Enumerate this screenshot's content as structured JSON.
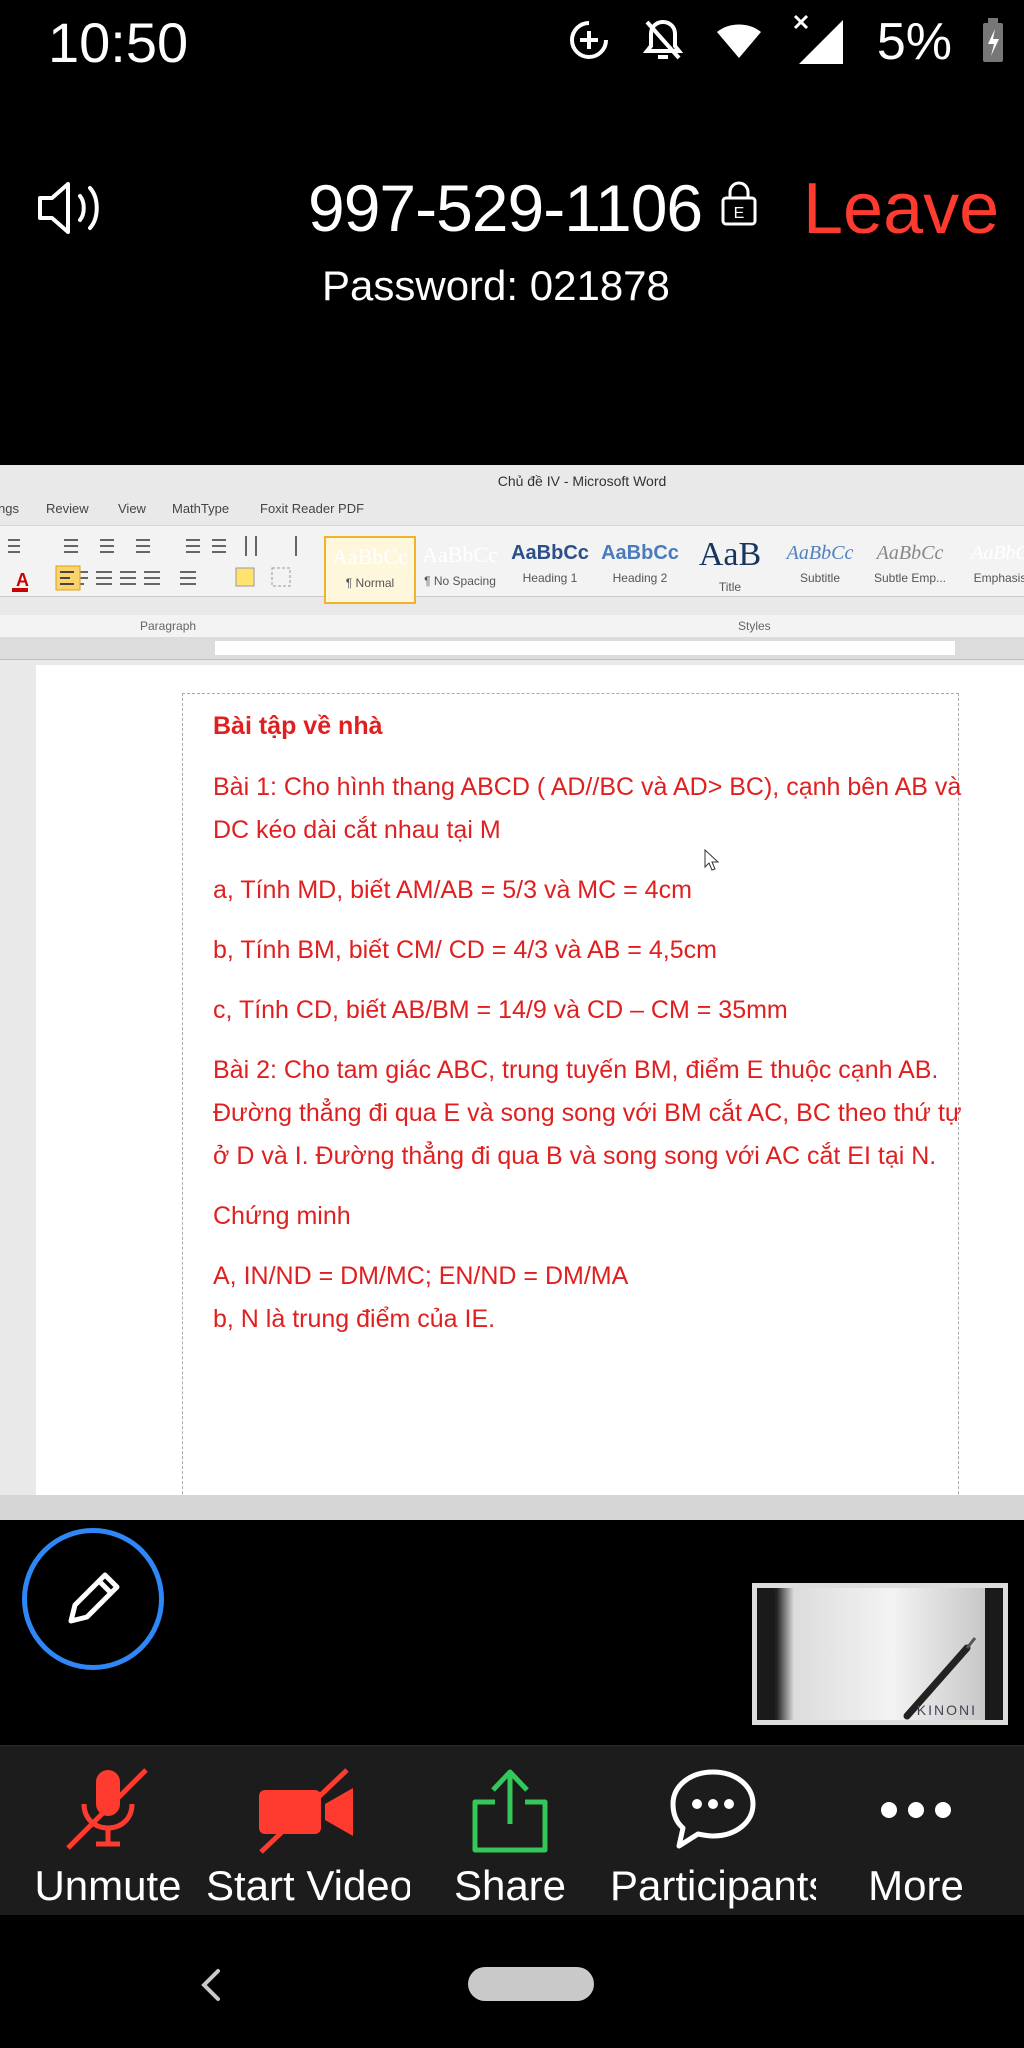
{
  "status_bar": {
    "time": "10:50",
    "battery": "5%",
    "icons": [
      "data-saver-icon",
      "notifications-off-icon",
      "wifi-icon",
      "cellular-signal-icon",
      "battery-charging-icon"
    ]
  },
  "meeting": {
    "id": "997-529-1106",
    "password": "Password: 021878",
    "leave_label": "Leave",
    "leave_color": "#ff3b30"
  },
  "word": {
    "title": "Chủ đề IV - Microsoft Word",
    "tabs": [
      "ngs",
      "Review",
      "View",
      "MathType",
      "Foxit Reader PDF"
    ],
    "styles": [
      {
        "sample": "AaBbCc",
        "name": "¶ Normal"
      },
      {
        "sample": "AaBbCc",
        "name": "¶ No Spacing"
      },
      {
        "sample": "AaBbCc",
        "name": "Heading 1"
      },
      {
        "sample": "AaBbCc",
        "name": "Heading 2"
      },
      {
        "sample": "AaB",
        "name": "Title"
      },
      {
        "sample": "AaBbCc",
        "name": "Subtitle"
      },
      {
        "sample": "AaBbCc",
        "name": "Subtle Emp..."
      },
      {
        "sample": "AaBbC",
        "name": "Emphasis"
      }
    ],
    "group_labels": {
      "paragraph": "Paragraph",
      "styles": "Styles"
    }
  },
  "document": {
    "title": "Bài tập về nhà",
    "lines": [
      "Bài 1: Cho hình thang ABCD ( AD//BC và AD> BC), cạnh bên AB và DC kéo dài cắt nhau tại M",
      "a, Tính MD, biết AM/AB = 5/3 và MC = 4cm",
      "b, Tính BM, biết CM/ CD = 4/3 và AB = 4,5cm",
      "c, Tính CD, biết AB/BM = 14/9 và CD – CM = 35mm",
      "Bài 2: Cho tam giác ABC, trung tuyến BM, điểm E thuộc cạnh AB. Đường thẳng đi qua E và song song với BM cắt AC, BC theo thứ tự ở D và I. Đường thẳng đi qua B và song song với AC cắt EI tại N.",
      "Chứng minh",
      "A, IN/ND = DM/MC; EN/ND = DM/MA",
      "b, N là trung điểm của IE."
    ],
    "text_color": "#e02020"
  },
  "video_thumb": {
    "watermark": "KINONI"
  },
  "toolbar": {
    "items": [
      {
        "label": "Unmute",
        "icon": "mic-muted-icon"
      },
      {
        "label": "Start Video",
        "icon": "video-off-icon"
      },
      {
        "label": "Share",
        "icon": "share-icon"
      },
      {
        "label": "Participants",
        "icon": "chat-bubble-icon"
      },
      {
        "label": "More",
        "icon": "more-icon"
      }
    ],
    "muted_color": "#ff3b30",
    "share_color": "#34c759"
  }
}
